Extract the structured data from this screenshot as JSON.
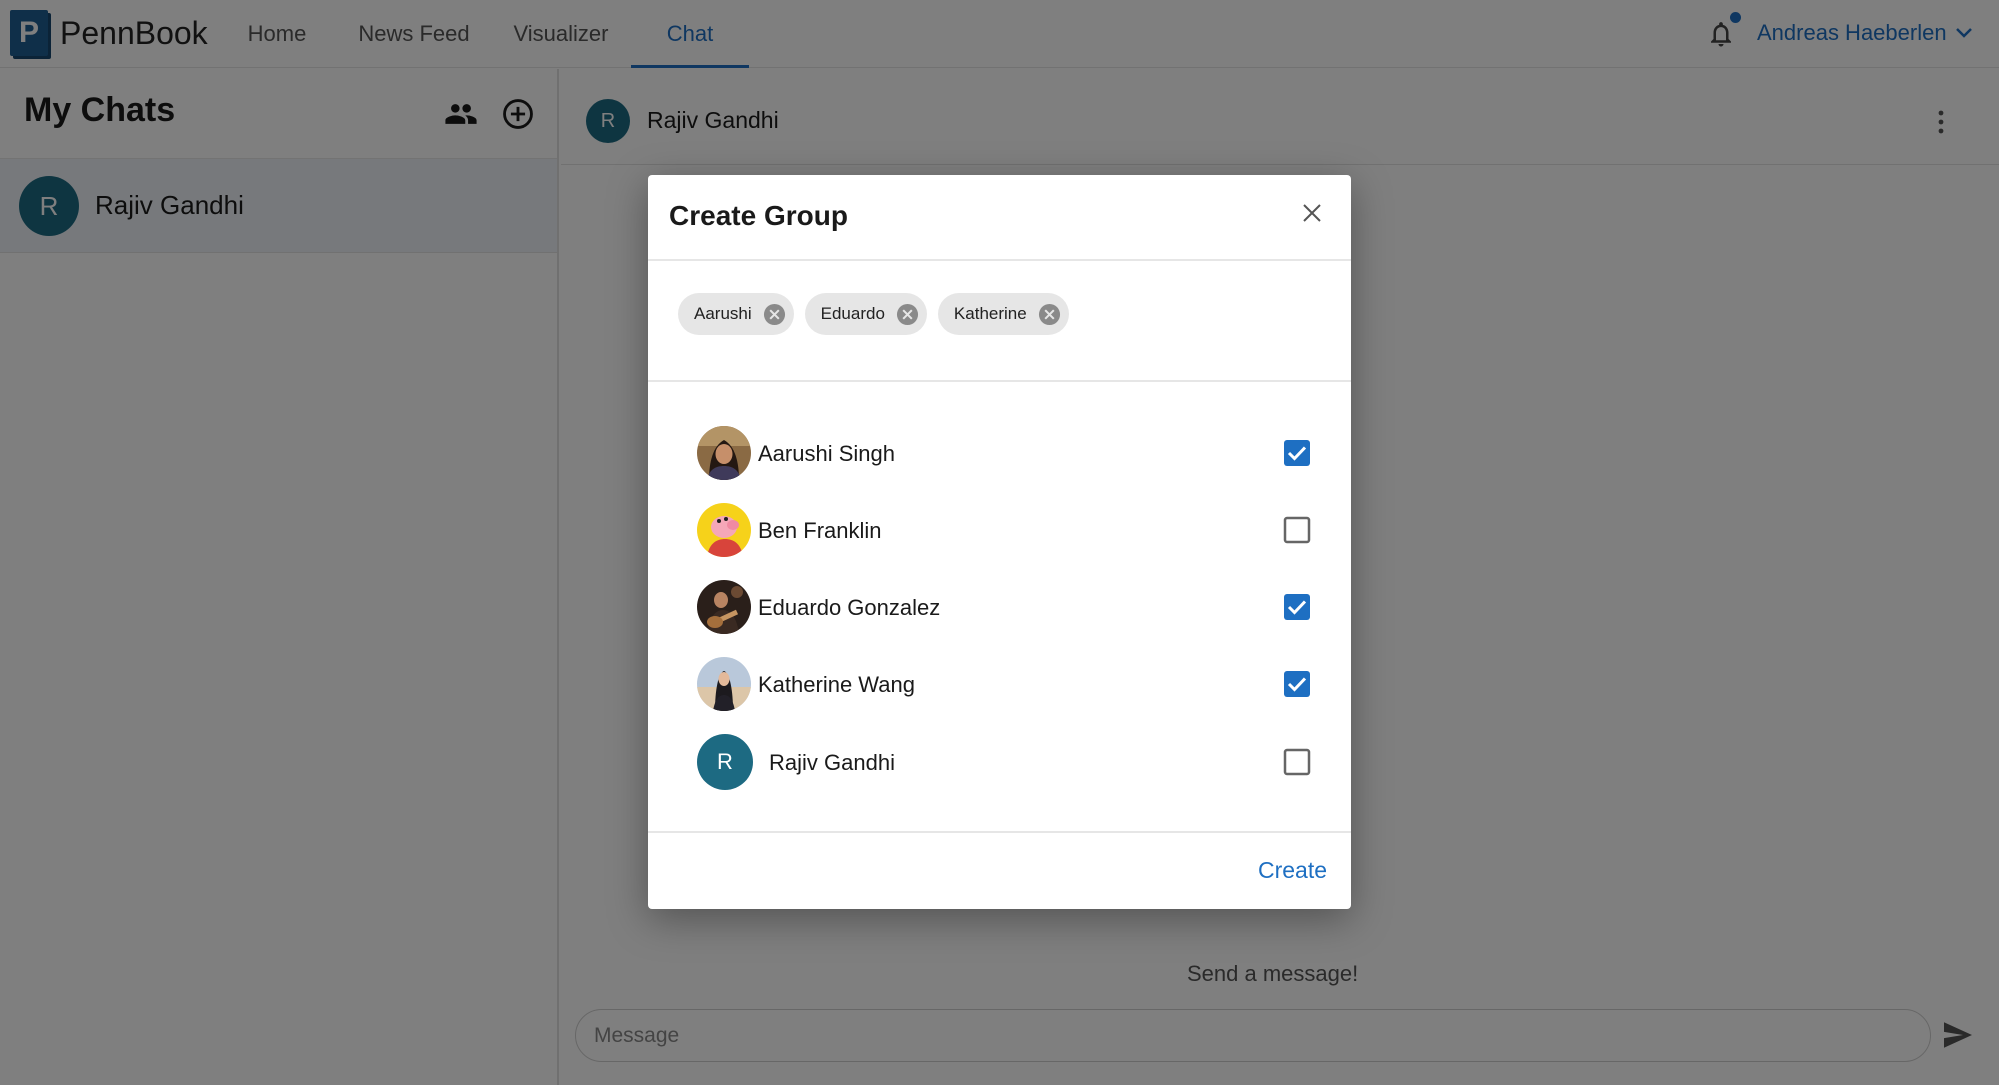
{
  "app": {
    "logo_letter": "P",
    "name": "PennBook"
  },
  "nav": {
    "tabs": [
      {
        "label": "Home",
        "active": false
      },
      {
        "label": "News Feed",
        "active": false
      },
      {
        "label": "Visualizer",
        "active": false
      },
      {
        "label": "Chat",
        "active": true
      }
    ],
    "notifications_unread": true,
    "user_name": "Andreas Haeberlen"
  },
  "sidebar": {
    "title": "My Chats",
    "chats": [
      {
        "initial": "R",
        "name": "Rajiv Gandhi",
        "selected": true
      }
    ]
  },
  "chat": {
    "header_initial": "R",
    "header_name": "Rajiv Gandhi",
    "empty_hint": "Send a message!",
    "input_placeholder": "Message"
  },
  "modal": {
    "title": "Create Group",
    "chips": [
      "Aarushi",
      "Eduardo",
      "Katherine"
    ],
    "members": [
      {
        "name": "Aarushi Singh",
        "checked": true,
        "avatar": "photo"
      },
      {
        "name": "Ben Franklin",
        "checked": false,
        "avatar": "photo"
      },
      {
        "name": "Eduardo Gonzalez",
        "checked": true,
        "avatar": "photo"
      },
      {
        "name": "Katherine Wang",
        "checked": true,
        "avatar": "photo"
      },
      {
        "name": "Rajiv Gandhi",
        "checked": false,
        "avatar": "initial",
        "initial": "R"
      }
    ],
    "create_label": "Create"
  },
  "colors": {
    "accent": "#1e6fc2",
    "brand": "#1f5f93",
    "avatar_teal": "#1d6a82",
    "checkbox_checked": "#1e6fc2"
  }
}
